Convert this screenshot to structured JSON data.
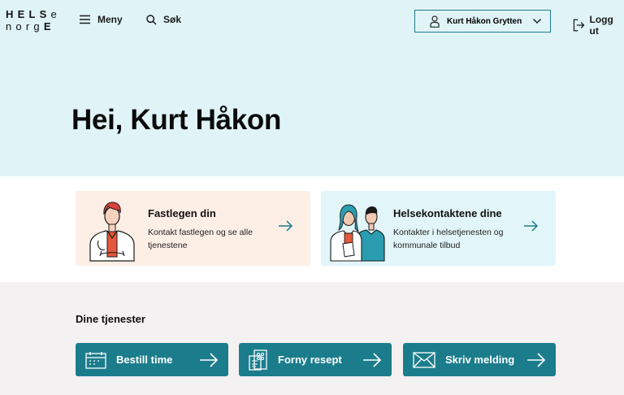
{
  "logo": {
    "row1": "HELSe",
    "row2": "norgE"
  },
  "nav": {
    "menu": "Meny",
    "search": "Søk",
    "user": "Kurt Håkon Grytten",
    "logout": "Logg ut"
  },
  "hero": {
    "greeting": "Hei, Kurt Håkon"
  },
  "contact_cards": [
    {
      "title": "Fastlegen din",
      "text": "Kontakt fastlegen og se alle tjenestene"
    },
    {
      "title": "Helsekontaktene dine",
      "text": "Kontakter i helsetjenesten og kommunale tilbud"
    }
  ],
  "services": {
    "heading": "Dine tjenester",
    "items": [
      {
        "label": "Bestill time",
        "icon": "calendar-icon"
      },
      {
        "label": "Forny resept",
        "icon": "prescription-icon"
      },
      {
        "label": "Skriv melding",
        "icon": "envelope-icon"
      }
    ]
  },
  "colors": {
    "hero_bg": "#e0f4f7",
    "accent": "#1b7d8c",
    "gp_card_bg": "#fdeee6",
    "contacts_card_bg": "#e2f5f8",
    "services_bg": "#f3f1f1"
  }
}
